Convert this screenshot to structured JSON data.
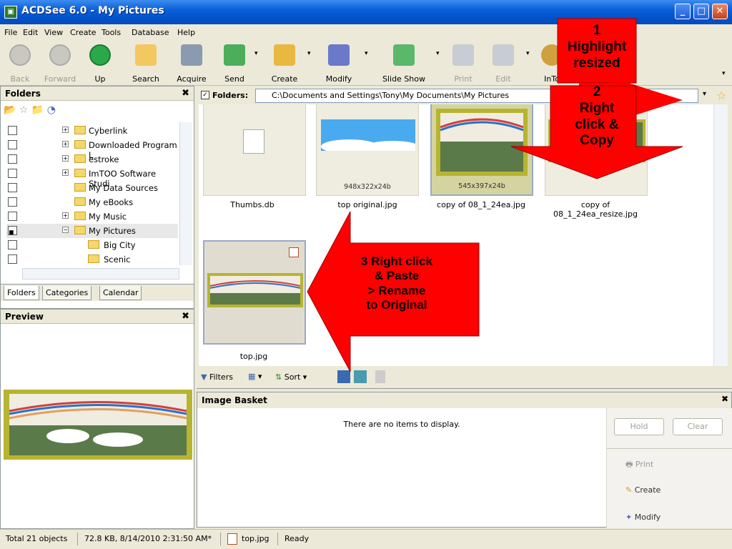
{
  "window": {
    "title": "ACDSee 6.0 - My Pictures",
    "app_icon": "acdsee-icon"
  },
  "menu": [
    "File",
    "Edit",
    "View",
    "Create",
    "Tools",
    "Database",
    "Help"
  ],
  "toolbar": {
    "back": "Back",
    "forward": "Forward",
    "up": "Up",
    "search": "Search",
    "acquire": "Acquire",
    "send": "Send",
    "create": "Create",
    "modify": "Modify",
    "slideshow": "Slide Show",
    "print": "Print",
    "edit": "Edit",
    "into": "InTo"
  },
  "folders_panel": {
    "title": "Folders",
    "tree": [
      {
        "label": "Cyberlink",
        "expand": "+"
      },
      {
        "label": "Downloaded Program L",
        "expand": "+"
      },
      {
        "label": "estroke",
        "expand": "+"
      },
      {
        "label": "ImTOO Software Studi",
        "expand": "+"
      },
      {
        "label": "My Data Sources",
        "expand": ""
      },
      {
        "label": "My eBooks",
        "expand": ""
      },
      {
        "label": "My Music",
        "expand": "+"
      },
      {
        "label": "My Pictures",
        "expand": "−"
      },
      {
        "label": "Big City",
        "expand": ""
      },
      {
        "label": "Scenic",
        "expand": ""
      }
    ],
    "tabs": [
      "Folders",
      "Categories",
      "Calendar"
    ]
  },
  "preview_panel": {
    "title": "Preview"
  },
  "path_bar": {
    "label": "Folders:",
    "path": "C:\\Documents and Settings\\Tony\\My Documents\\My Pictures"
  },
  "files": [
    {
      "name": "Thumbs.db",
      "dims": ""
    },
    {
      "name": "top original.jpg",
      "dims": "948x322x24b"
    },
    {
      "name": "copy of 08_1_24ea.jpg",
      "dims": "545x397x24b"
    },
    {
      "name": "copy of\n08_1_24ea_resize.jpg",
      "dims": ""
    },
    {
      "name": "top.jpg",
      "dims": ""
    }
  ],
  "filterbar": {
    "filters": "Filters",
    "sort": "Sort"
  },
  "basket": {
    "title": "Image Basket",
    "empty": "There are no items to display.",
    "hold": "Hold",
    "clear": "Clear",
    "print": "Print",
    "create": "Create",
    "modify": "Modify"
  },
  "status": {
    "objects": "Total 21 objects",
    "info": "72.8 KB, 8/14/2010 2:31:50 AM*",
    "file": "top.jpg",
    "state": "Ready"
  },
  "callouts": {
    "c1_num": "1",
    "c1_text1": "Highlight",
    "c1_text2": "resized",
    "c2_num": "2",
    "c2_text1": "Right",
    "c2_text2": "click &",
    "c2_text3": "Copy",
    "c3_text1": "3 Right click",
    "c3_text2": "& Paste",
    "c3_text3": "> Rename",
    "c3_text4": "to Original"
  },
  "colors": {
    "callout": "#ff0000",
    "titlebar": "#0a5fd8"
  }
}
